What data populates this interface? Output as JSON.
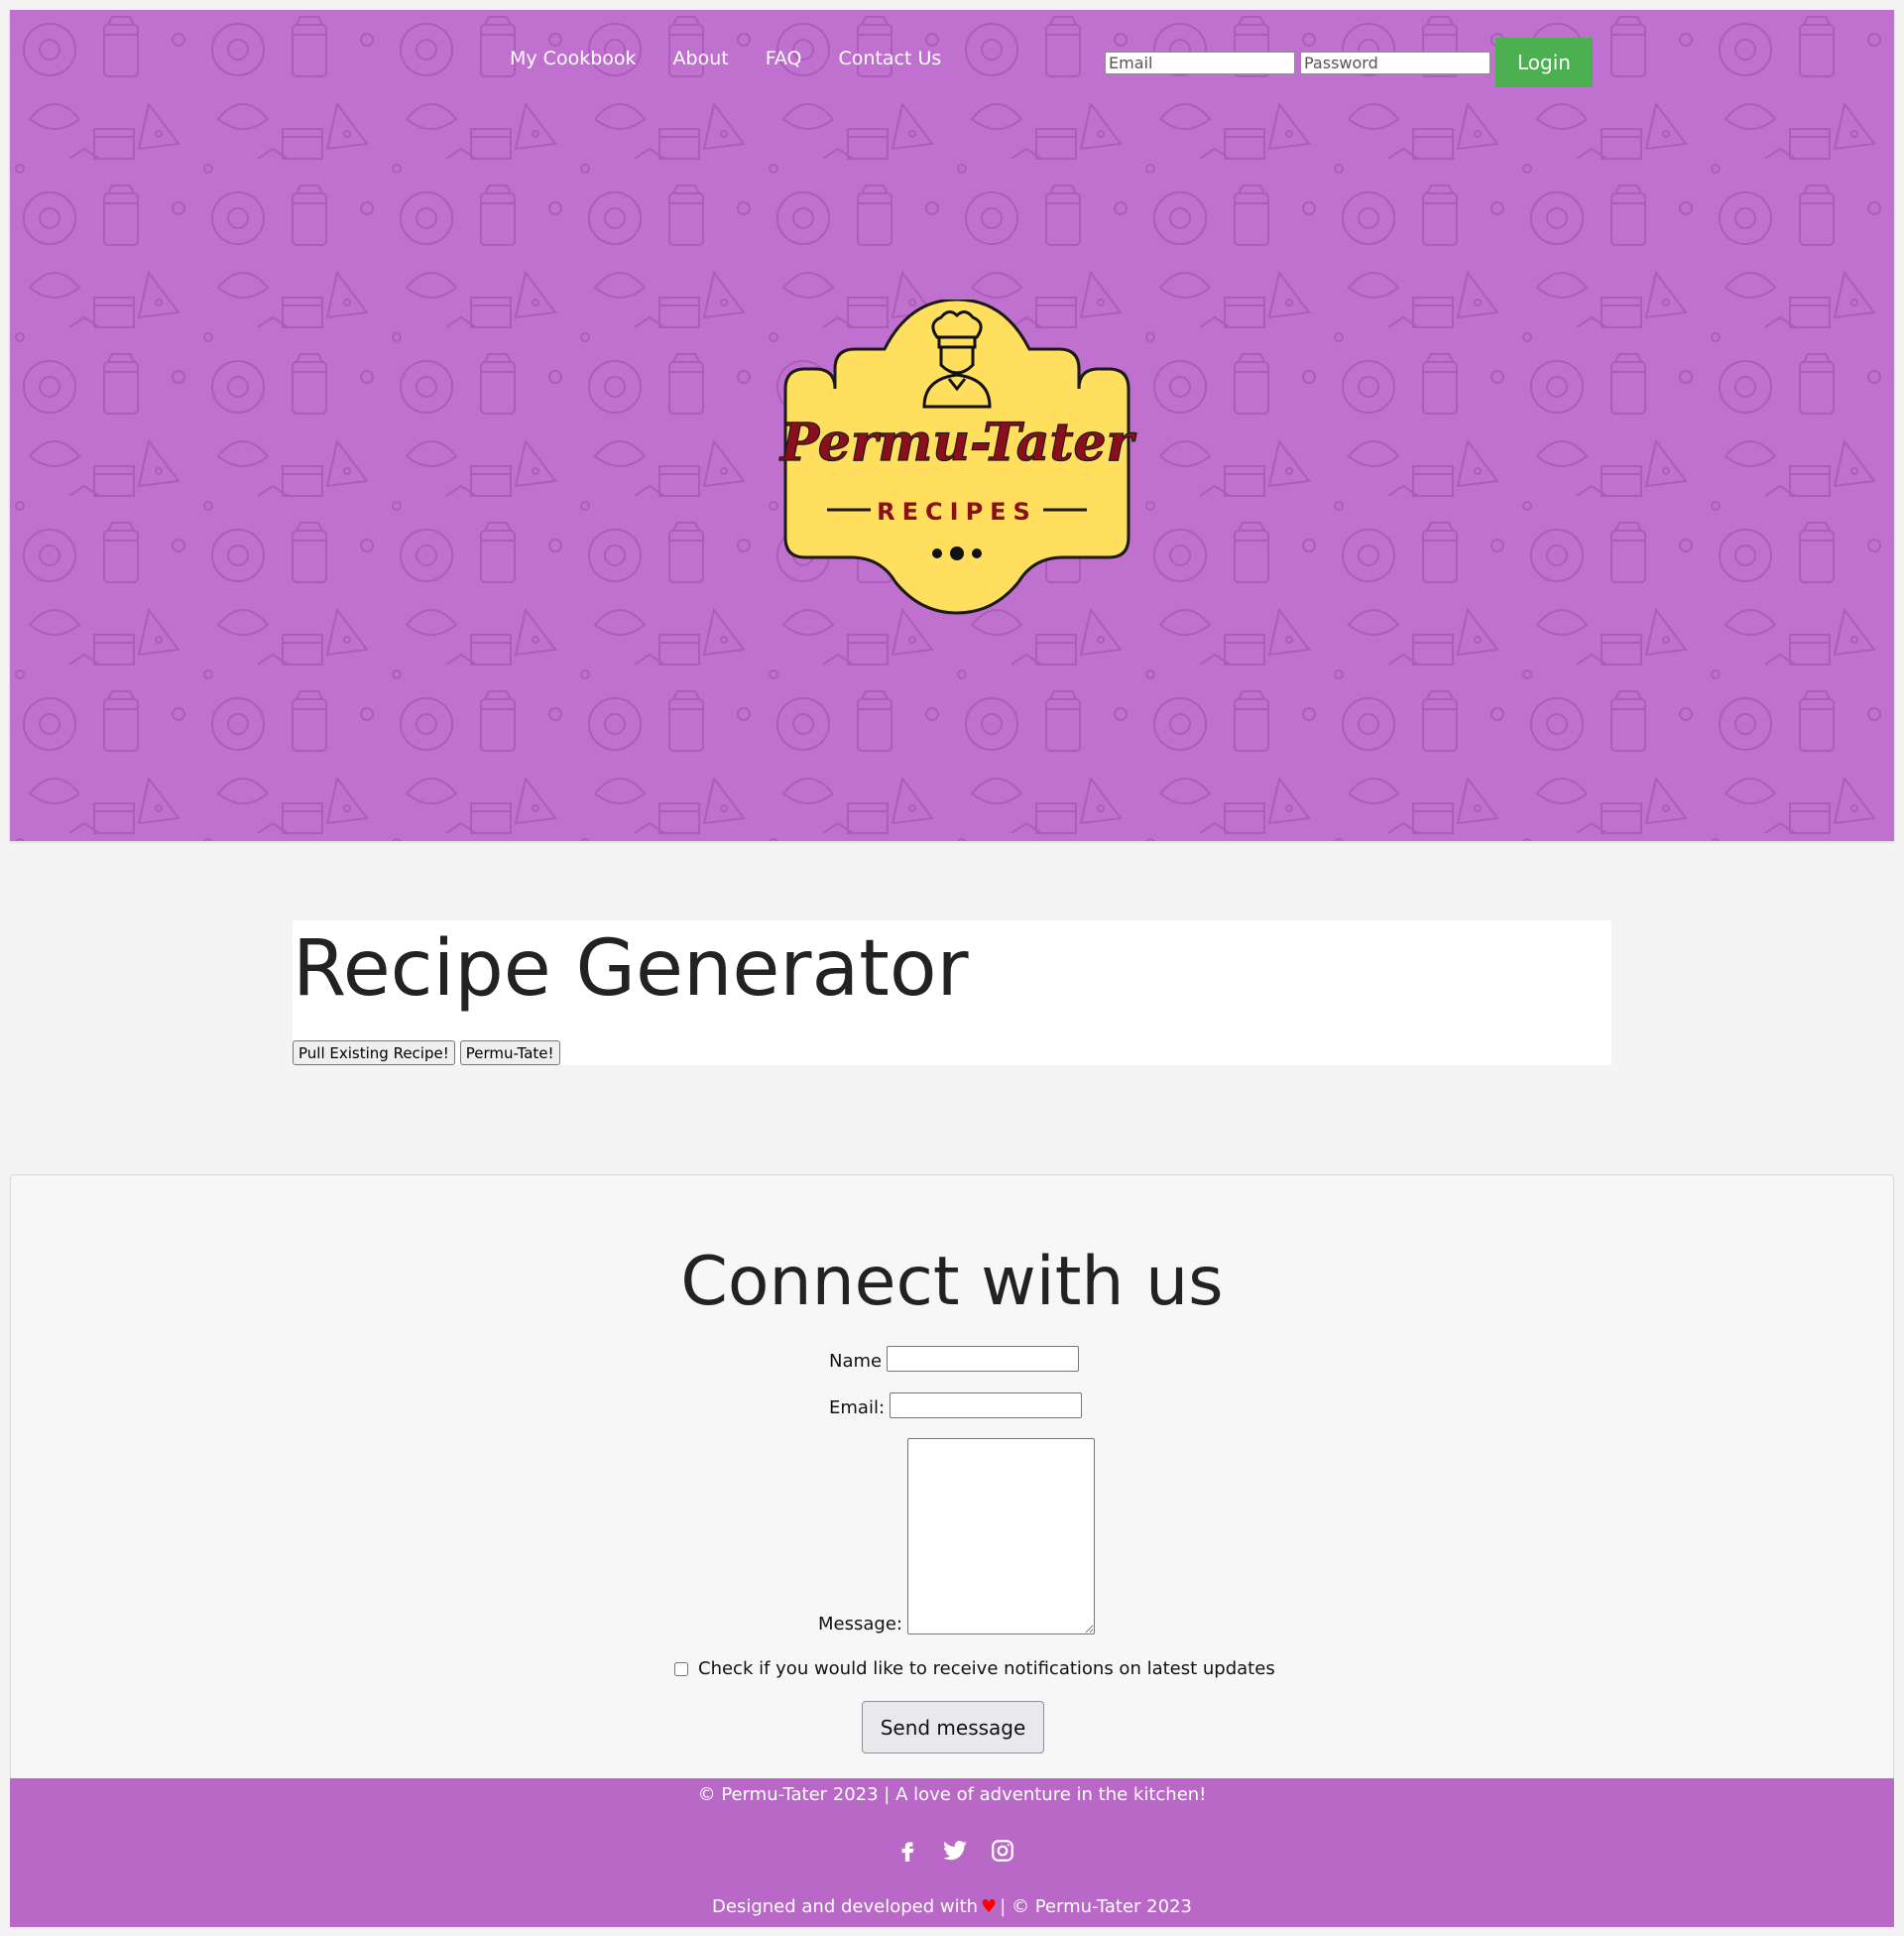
{
  "nav": {
    "items": [
      "My Cookbook",
      "About",
      "FAQ",
      "Contact Us"
    ]
  },
  "login": {
    "email_placeholder": "Email",
    "password_placeholder": "Password",
    "button_label": "Login"
  },
  "logo": {
    "title": "Permu-Tater",
    "subtitle": "RECIPES"
  },
  "generator": {
    "title": "Recipe Generator",
    "pull_label": "Pull Existing Recipe!",
    "permutate_label": "Permu-Tate!"
  },
  "connect": {
    "title": "Connect with us",
    "name_label": "Name",
    "email_label": "Email:",
    "message_label": "Message:",
    "checkbox_label": "Check if you would like to receive notifications on latest updates",
    "send_label": "Send message"
  },
  "footer": {
    "line1": "© Permu-Tater 2023 | A love of adventure in the kitchen!",
    "designed_prefix": "Designed and developed with",
    "designed_suffix": "| © Permu-Tater 2023",
    "social": [
      "facebook-icon",
      "twitter-icon",
      "instagram-icon"
    ]
  },
  "colors": {
    "hero": "#c070cf",
    "footer": "#ba68c8",
    "login_button": "#4caf50",
    "logo_fill": "#ffdf5d",
    "logo_text": "#8b0f1a"
  }
}
